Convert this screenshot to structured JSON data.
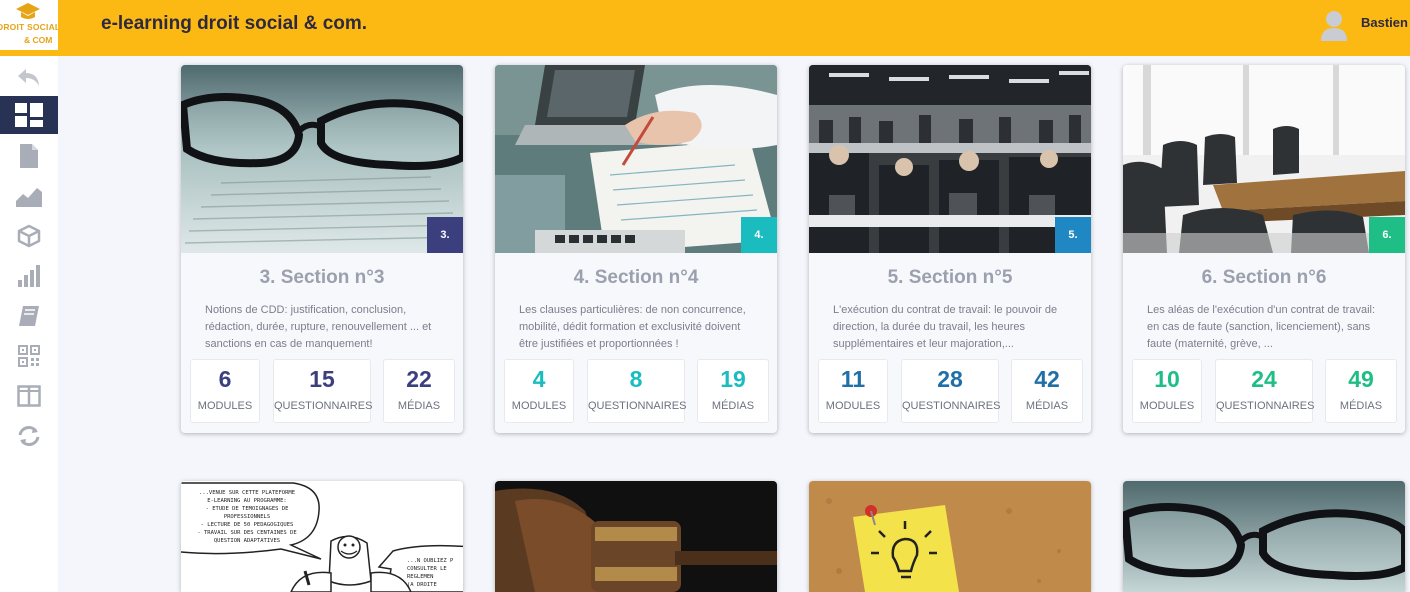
{
  "header": {
    "logo_line1": "DROIT SOCIAL",
    "logo_line2": "& COM",
    "title": "e-learning droit social & com.",
    "user_name": "Bastien"
  },
  "sidebar": {
    "items": [
      {
        "icon": "back-icon"
      },
      {
        "icon": "dashboard-icon",
        "active": true
      },
      {
        "icon": "document-icon"
      },
      {
        "icon": "area-chart-icon"
      },
      {
        "icon": "cube-icon"
      },
      {
        "icon": "bar-chart-icon"
      },
      {
        "icon": "book-icon"
      },
      {
        "icon": "qr-code-icon"
      },
      {
        "icon": "columns-icon"
      },
      {
        "icon": "refresh-icon"
      }
    ]
  },
  "cards": [
    {
      "badge": "3.",
      "badge_color": "#3b3f7e",
      "title": "3. Section n°3",
      "description": "Notions de CDD: justification, conclusion, rédaction, durée, rupture, renouvellement ... et sanctions en cas de manquement!",
      "number_color": "#3b3f7e",
      "stats": [
        {
          "value": "6",
          "label": "MODULES"
        },
        {
          "value": "15",
          "label": "QUESTIONNAIRES"
        },
        {
          "value": "22",
          "label": "MÉDIAS"
        }
      ]
    },
    {
      "badge": "4.",
      "badge_color": "#1bbcc0",
      "title": "4. Section n°4",
      "description": "Les clauses particulières: de non concurrence, mobilité, dédit formation et exclusivité doivent être justifiées et proportionnées !",
      "number_color": "#1bbcc0",
      "stats": [
        {
          "value": "4",
          "label": "MODULES"
        },
        {
          "value": "8",
          "label": "QUESTIONNAIRES"
        },
        {
          "value": "19",
          "label": "MÉDIAS"
        }
      ]
    },
    {
      "badge": "5.",
      "badge_color": "#1f88c2",
      "title": "5. Section n°5",
      "description": "L'exécution du contrat de travail: le pouvoir de direction, la durée du travail, les heures supplémentaires et leur majoration,...",
      "number_color": "#1f6fa8",
      "stats": [
        {
          "value": "11",
          "label": "MODULES"
        },
        {
          "value": "28",
          "label": "QUESTIONNAIRES"
        },
        {
          "value": "42",
          "label": "MÉDIAS"
        }
      ]
    },
    {
      "badge": "6.",
      "badge_color": "#1fbe86",
      "title": "6. Section n°6",
      "description": "Les aléas de l'exécution d'un contrat de travail: en cas de faute (sanction, licenciement), sans faute (maternité, grève, ...",
      "number_color": "#1fbe86",
      "stats": [
        {
          "value": "10",
          "label": "MODULES"
        },
        {
          "value": "24",
          "label": "QUESTIONNAIRES"
        },
        {
          "value": "49",
          "label": "MÉDIAS"
        }
      ]
    }
  ],
  "comic": {
    "bubble1": [
      "...VENUE SUR CETTE PLATEFORME",
      "E-LEARNING AU PROGRAMME:",
      "- ETUDE DE TEMOIGNAGES DE",
      "PROFESSIONNELS",
      "- LECTURE DE 50 PEDAGOGIQUES",
      "- TRAVAIL SUR DES CENTAINES DE",
      "QUESTION ADAPTATIVES"
    ],
    "bubble2": [
      "...N OUBLIEZ P",
      "CONSULTER LE",
      "REGLEMEN",
      "(A DROITE"
    ]
  },
  "colors": {
    "header": "#fdb913",
    "sidebar_active": "#283254",
    "background": "#f4f6fb"
  }
}
